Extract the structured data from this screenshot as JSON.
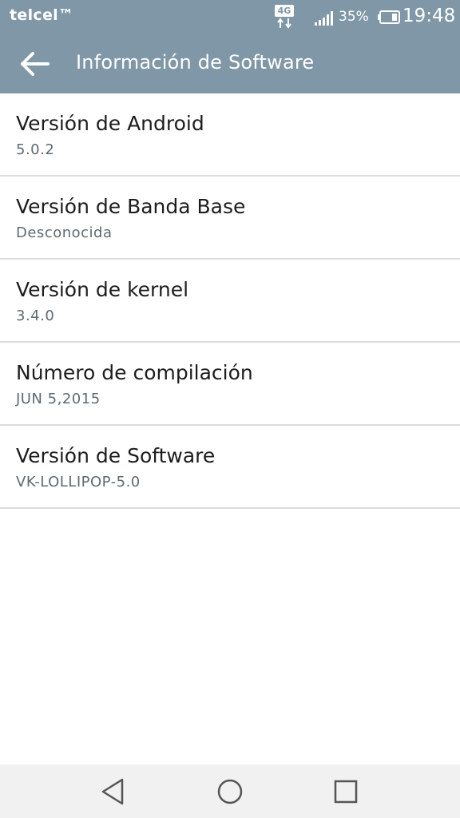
{
  "status": {
    "carrier": "telcel™",
    "network": "4G",
    "battery_percent": "35%",
    "time": "19:48"
  },
  "app_bar": {
    "title": "Información de Software"
  },
  "items": [
    {
      "title": "Versión de Android",
      "value": "5.0.2"
    },
    {
      "title": "Versión de Banda Base",
      "value": "Desconocida"
    },
    {
      "title": "Versión de kernel",
      "value": "3.4.0"
    },
    {
      "title": "Número de compilación",
      "value": "JUN 5,2015"
    },
    {
      "title": "Versión de Software",
      "value": "VK-LOLLIPOP-5.0"
    }
  ],
  "icons": {
    "back": "arrow-left-icon",
    "nav_back": "triangle-back-icon",
    "nav_home": "circle-home-icon",
    "nav_recents": "square-recents-icon"
  },
  "colors": {
    "bar": "#7f97a6",
    "nav_bg": "#f1f1f1",
    "divider": "#dcdcdc"
  }
}
